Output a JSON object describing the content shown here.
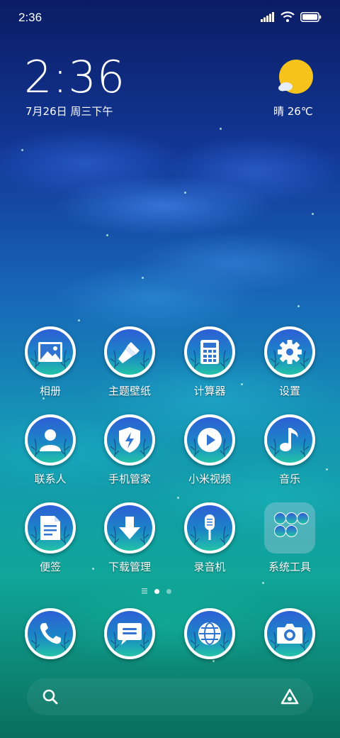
{
  "status_bar": {
    "time": "2:36"
  },
  "clock_widget": {
    "time": "2:36",
    "date": "7月26日 周三下午",
    "weather": "晴 26℃"
  },
  "apps": [
    {
      "label": "相册",
      "icon": "gallery-icon"
    },
    {
      "label": "主题壁纸",
      "icon": "paintbrush-icon"
    },
    {
      "label": "计算器",
      "icon": "calculator-icon"
    },
    {
      "label": "设置",
      "icon": "gear-icon"
    },
    {
      "label": "联系人",
      "icon": "person-icon"
    },
    {
      "label": "手机管家",
      "icon": "shield-bolt-icon"
    },
    {
      "label": "小米视频",
      "icon": "play-icon"
    },
    {
      "label": "音乐",
      "icon": "music-note-icon"
    },
    {
      "label": "便签",
      "icon": "note-icon"
    },
    {
      "label": "下载管理",
      "icon": "download-icon"
    },
    {
      "label": "录音机",
      "icon": "microphone-icon"
    },
    {
      "label": "系统工具",
      "icon": "folder-icon"
    }
  ],
  "dock": [
    "phone-icon",
    "message-icon",
    "browser-icon",
    "camera-icon"
  ],
  "colors": {
    "icon_gradient_top": "#2e5fd6",
    "icon_gradient_bottom": "#22c3a8",
    "sun": "#f6c21c"
  }
}
